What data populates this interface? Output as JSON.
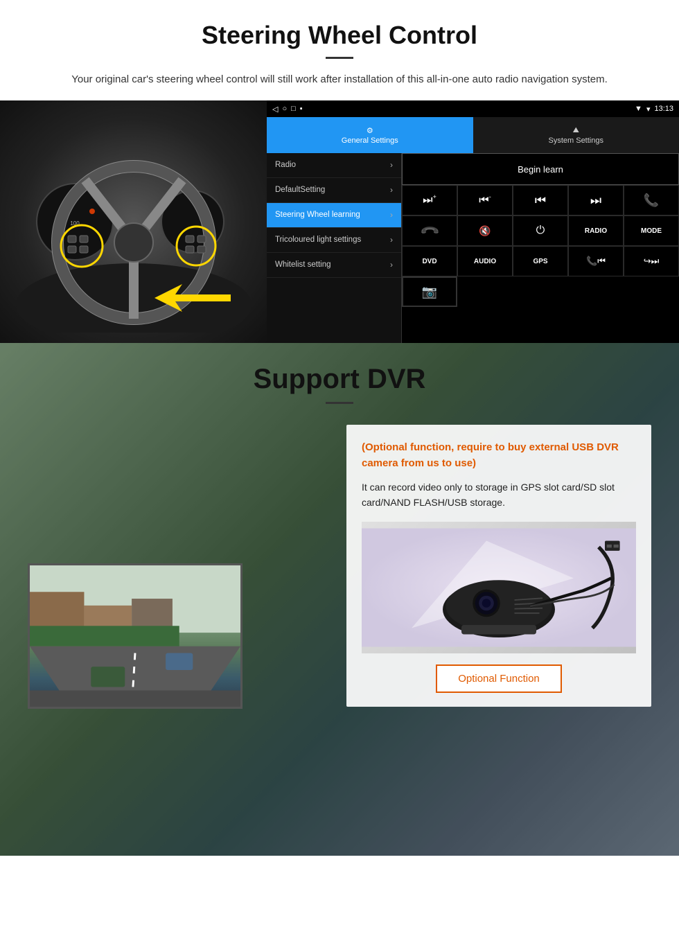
{
  "steering": {
    "title": "Steering Wheel Control",
    "description": "Your original car's steering wheel control will still work after installation of this all-in-one auto radio navigation system.",
    "statusbar": {
      "time": "13:13",
      "icons": [
        "signal",
        "wifi",
        "battery"
      ]
    },
    "nav_icons": [
      "◁",
      "○",
      "□",
      "⬛"
    ],
    "tabs": [
      {
        "label": "General Settings",
        "icon": "⚙",
        "active": true
      },
      {
        "label": "System Settings",
        "icon": "🌐",
        "active": false
      }
    ],
    "menu_items": [
      {
        "label": "Radio",
        "active": false
      },
      {
        "label": "DefaultSetting",
        "active": false
      },
      {
        "label": "Steering Wheel learning",
        "active": true
      },
      {
        "label": "Tricoloured light settings",
        "active": false
      },
      {
        "label": "Whitelist setting",
        "active": false
      }
    ],
    "begin_learn_label": "Begin learn",
    "control_buttons": [
      {
        "label": "⏭+",
        "row": 1
      },
      {
        "label": "⏮-",
        "row": 1
      },
      {
        "label": "⏮⏮",
        "row": 1
      },
      {
        "label": "⏭⏭",
        "row": 1
      },
      {
        "label": "📞",
        "row": 1
      },
      {
        "label": "↩",
        "row": 2
      },
      {
        "label": "🔇",
        "row": 2
      },
      {
        "label": "⏻",
        "row": 2
      },
      {
        "label": "RADIO",
        "row": 2
      },
      {
        "label": "MODE",
        "row": 2
      },
      {
        "label": "DVD",
        "row": 3
      },
      {
        "label": "AUDIO",
        "row": 3
      },
      {
        "label": "GPS",
        "row": 3
      },
      {
        "label": "📞⏮",
        "row": 3
      },
      {
        "label": "↪⏭",
        "row": 3
      },
      {
        "label": "📷",
        "row": 4
      }
    ]
  },
  "dvr": {
    "title": "Support DVR",
    "optional_text": "(Optional function, require to buy external USB DVR camera from us to use)",
    "description": "It can record video only to storage in GPS slot card/SD slot card/NAND FLASH/USB storage.",
    "optional_button_label": "Optional Function"
  }
}
